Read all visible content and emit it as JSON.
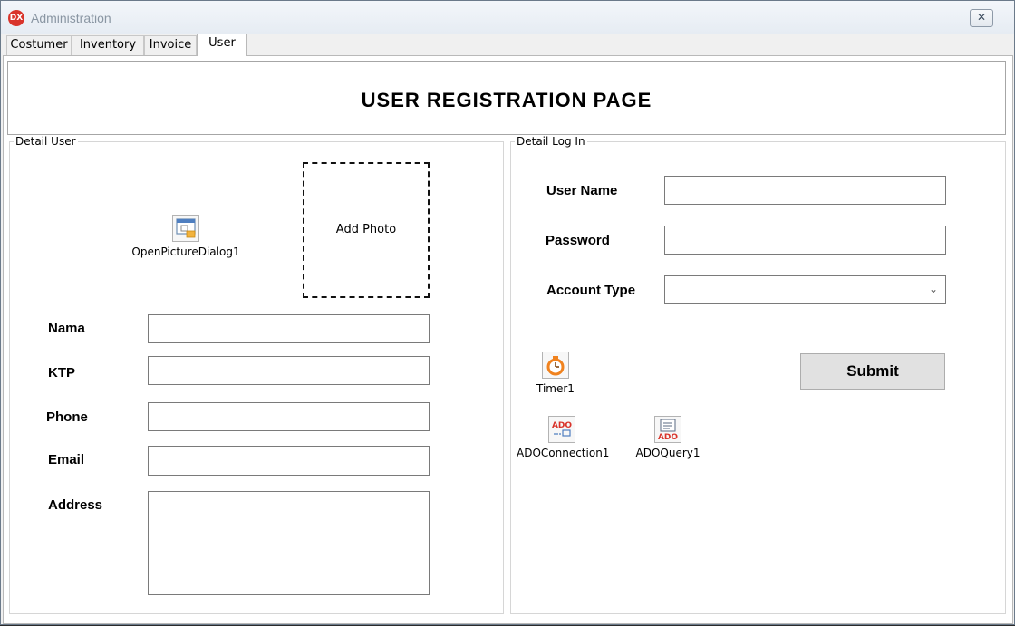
{
  "window": {
    "title": "Administration",
    "app_icon_text": "DX",
    "close_glyph": "✕"
  },
  "tabs": [
    {
      "label": "Costumer"
    },
    {
      "label": "Inventory"
    },
    {
      "label": "Invoice"
    },
    {
      "label": "User"
    }
  ],
  "header": {
    "title": "USER REGISTRATION PAGE"
  },
  "detail_user": {
    "group_label": "Detail User",
    "photo_label": "Add Photo",
    "dialog_component": "OpenPictureDialog1",
    "fields": {
      "nama": {
        "label": "Nama",
        "value": ""
      },
      "ktp": {
        "label": "KTP",
        "value": ""
      },
      "phone": {
        "label": "Phone",
        "value": ""
      },
      "email": {
        "label": "Email",
        "value": ""
      },
      "address": {
        "label": "Address",
        "value": ""
      }
    }
  },
  "detail_login": {
    "group_label": "Detail Log In",
    "fields": {
      "username": {
        "label": "User Name",
        "value": ""
      },
      "password": {
        "label": "Password",
        "value": ""
      },
      "account_type": {
        "label": "Account Type",
        "value": ""
      }
    },
    "submit_label": "Submit",
    "components": {
      "timer": "Timer1",
      "ado_connection": "ADOConnection1",
      "ado_query": "ADOQuery1"
    }
  },
  "colors": {
    "accent_red": "#d9342b",
    "timer_orange": "#f0821e"
  }
}
